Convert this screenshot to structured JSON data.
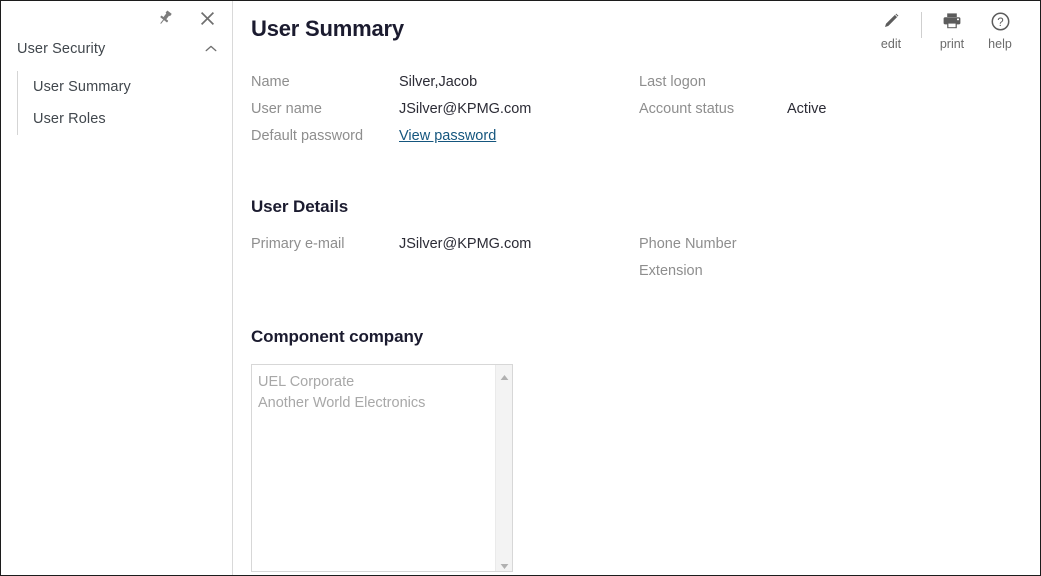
{
  "sidebar": {
    "controls": [
      {
        "name": "pin-icon",
        "label": "pin"
      },
      {
        "name": "close-icon",
        "label": "close"
      }
    ],
    "section": {
      "label": "User Security",
      "expanded": true,
      "chevron": "chevron-up-icon"
    },
    "items": [
      {
        "label": "User Summary"
      },
      {
        "label": "User Roles"
      }
    ]
  },
  "header": {
    "title": "User Summary",
    "tools": [
      {
        "label": "edit",
        "icon": "pencil-icon"
      },
      {
        "label": "print",
        "icon": "printer-icon"
      },
      {
        "label": "help",
        "icon": "question-circle-icon"
      }
    ]
  },
  "summary": {
    "fields": [
      {
        "label": "Name",
        "value": "Silver,Jacob"
      },
      {
        "label": "Last logon",
        "value": ""
      },
      {
        "label": "User name",
        "value": "JSilver@KPMG.com"
      },
      {
        "label": "Account status",
        "value": "Active"
      },
      {
        "label": "Default password",
        "value": "View password",
        "link": true
      },
      {
        "label": "",
        "value": ""
      }
    ]
  },
  "user_details": {
    "title": "User Details",
    "fields": [
      {
        "label": "Primary e-mail",
        "value": "JSilver@KPMG.com"
      },
      {
        "label": "Phone Number",
        "value": ""
      },
      {
        "label": "",
        "value": ""
      },
      {
        "label": "Extension",
        "value": ""
      }
    ]
  },
  "component_company": {
    "title": "Component company",
    "items": [
      "UEL Corporate",
      "Another World Electronics"
    ],
    "scrollbar": {
      "up": "scroll-up-arrow-icon",
      "down": "scroll-down-arrow-icon"
    }
  },
  "colors": {
    "heading": "#1b1b2f",
    "label": "#8e8e8e",
    "value": "#2b2b35",
    "link": "#15567e",
    "muted_list": "#a8a8a8",
    "border": "#d7d7d7",
    "icon": "#7a7a7a"
  }
}
